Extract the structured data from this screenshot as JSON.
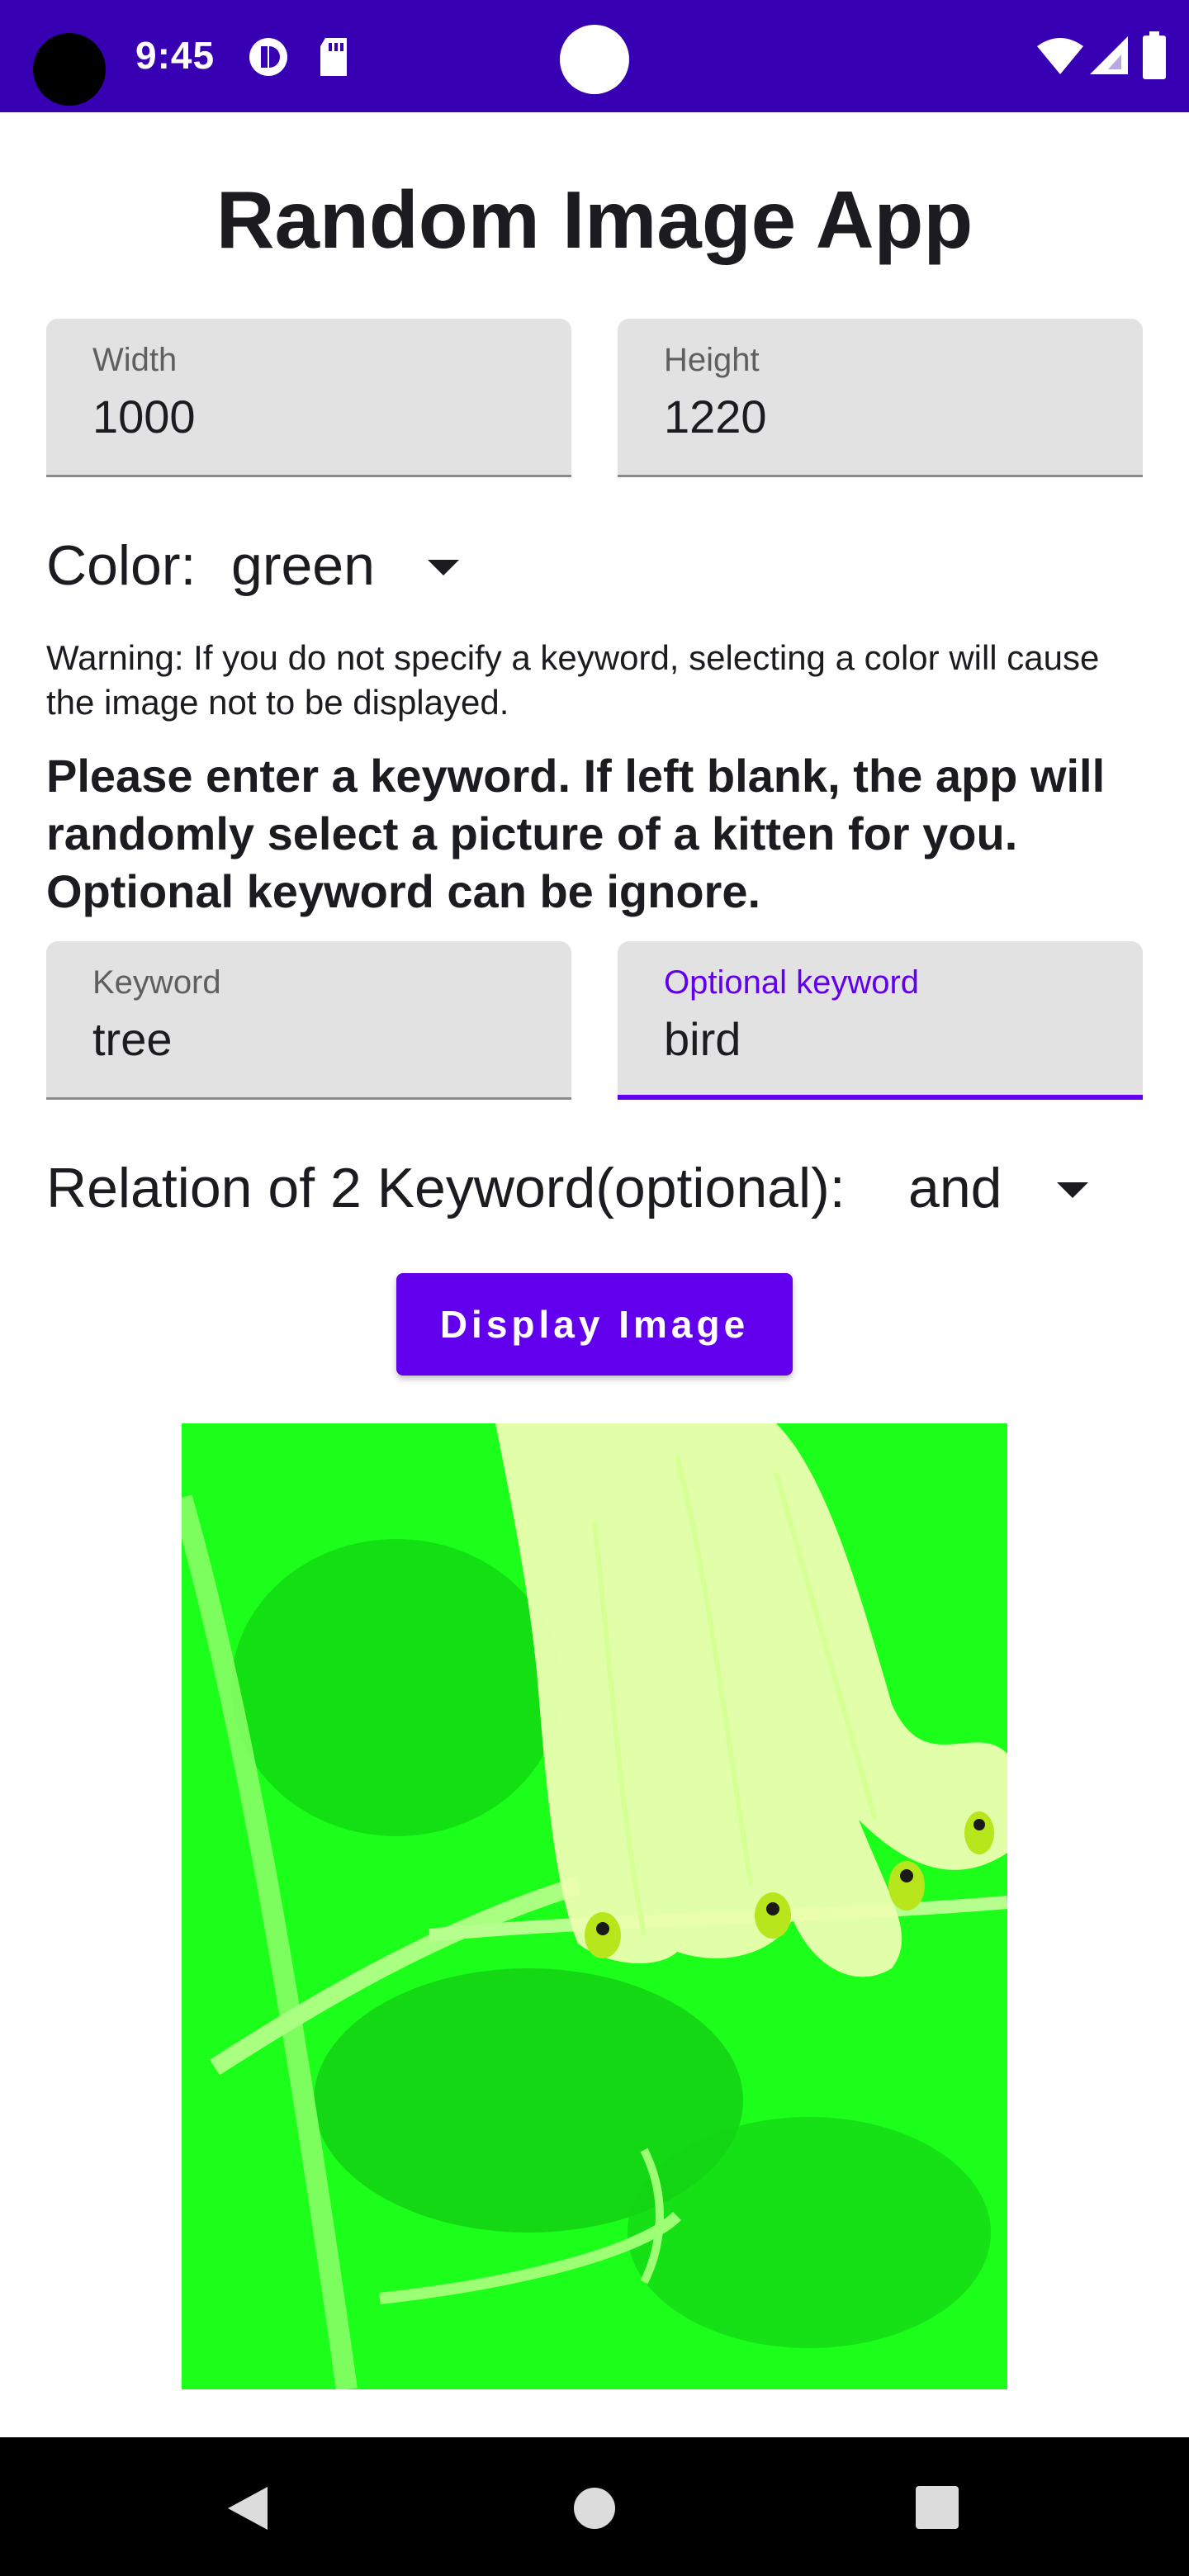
{
  "status_bar": {
    "time": "9:45"
  },
  "app": {
    "title": "Random Image App"
  },
  "dimensions": {
    "width_label": "Width",
    "width_value": "1000",
    "height_label": "Height",
    "height_value": "1220"
  },
  "color": {
    "label": "Color:",
    "selected": "green"
  },
  "warning_text": "Warning: If you do not specify a keyword, selecting a color will cause the image not to be displayed.",
  "instruction_text": "Please enter a keyword. If left blank, the app will randomly select a picture of a kitten for you. Optional keyword can be ignore.",
  "keywords": {
    "keyword_label": "Keyword",
    "keyword_value": "tree",
    "optional_label": "Optional keyword",
    "optional_value": "bird"
  },
  "relation": {
    "label": "Relation of 2 Keyword(optional):",
    "selected": "and"
  },
  "display_button": {
    "label": "Display Image"
  },
  "colors": {
    "status_bar": "#3700b3",
    "accent": "#6200ee",
    "image_tint": "#1bff1b"
  }
}
